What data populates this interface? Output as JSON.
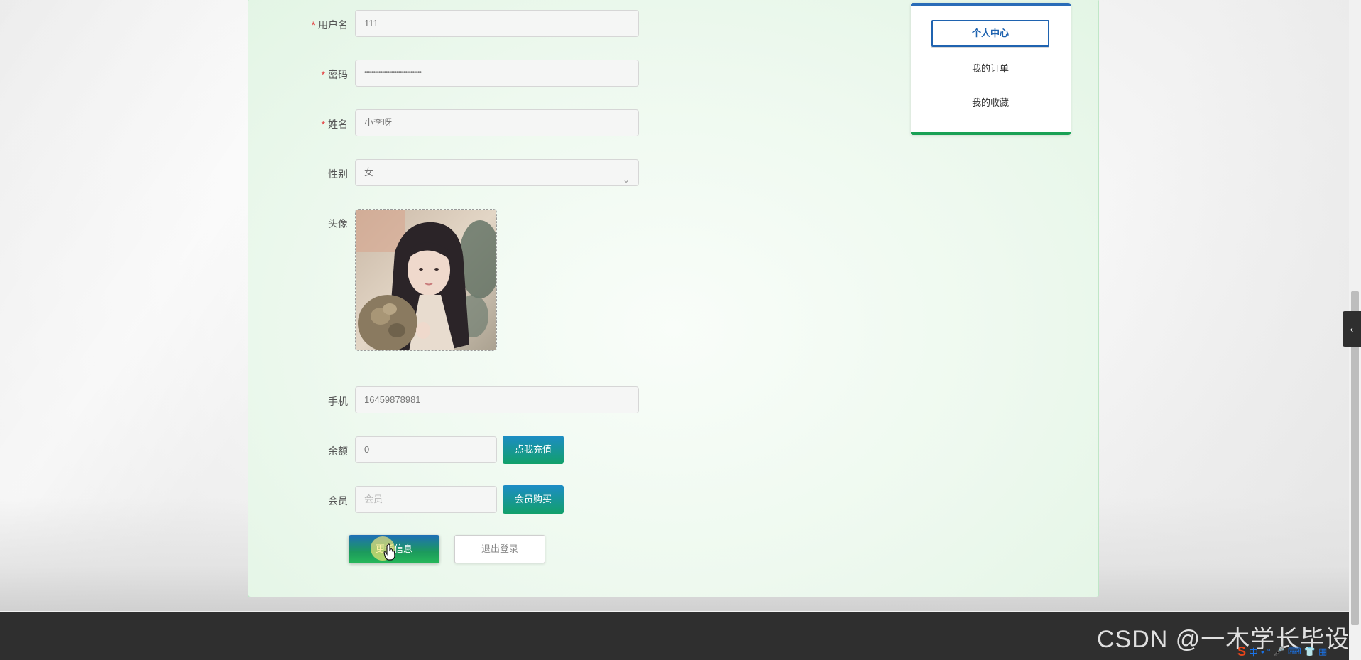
{
  "form": {
    "username": {
      "label": "用户名",
      "value": "111",
      "required": "*"
    },
    "password": {
      "label": "密码",
      "value": "••••••••••••••••••••••••••••••••",
      "required": "*"
    },
    "name": {
      "label": "姓名",
      "value": "小李呀",
      "required": "*"
    },
    "gender": {
      "label": "性别",
      "value": "女"
    },
    "avatar": {
      "label": "头像"
    },
    "phone": {
      "label": "手机",
      "value": "16459878981"
    },
    "balance": {
      "label": "余额",
      "value": "0",
      "button": "点我充值"
    },
    "member": {
      "label": "会员",
      "placeholder": "会员",
      "button": "会员购买"
    },
    "submit": "更新信息",
    "logout": "退出登录"
  },
  "side_menu": {
    "items": [
      {
        "label": "个人中心",
        "active": true
      },
      {
        "label": "我的订单"
      },
      {
        "label": "我的收藏"
      }
    ]
  },
  "watermark": "CSDN @一木学长毕设",
  "ime": {
    "logo": "S",
    "mode": "中",
    "icons": [
      "•",
      "°",
      "🎤",
      "⌨",
      "👕",
      "▦"
    ]
  },
  "side_toggle_glyph": "‹",
  "select_chevron": "⌄",
  "colors": {
    "accent_blue": "#1f63b0",
    "accent_green": "#1aa155",
    "footer": "#2f2f2f"
  }
}
